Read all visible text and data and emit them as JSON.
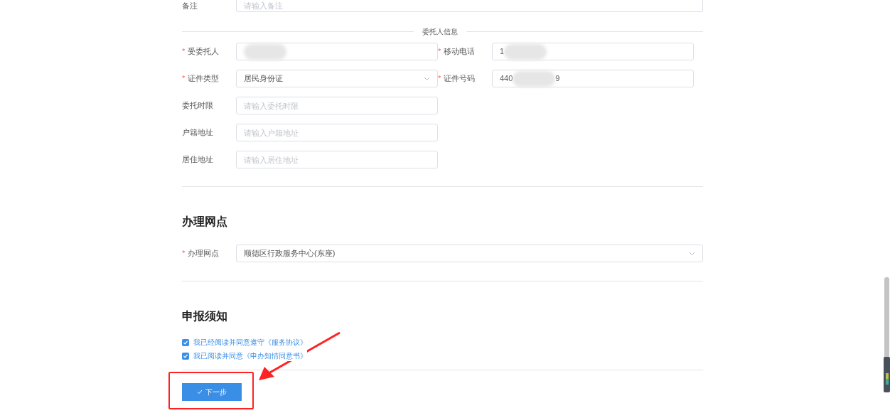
{
  "remark": {
    "label": "备注",
    "placeholder": "请输入备注"
  },
  "principal_section": {
    "title": "委托人信息",
    "fields": [
      {
        "label": "受委托人",
        "required_mark": "*",
        "kind": "blurred"
      },
      {
        "label": "移动电话",
        "required_mark": "*",
        "kind": "blurred",
        "value_start": "1"
      },
      {
        "label": "证件类型",
        "required_mark": "*",
        "kind": "select",
        "value": "居民身份证"
      },
      {
        "label": "证件号码",
        "required_mark": "*",
        "kind": "blurred",
        "value_start": "440",
        "value_end": "9"
      },
      {
        "label": "委托时限",
        "kind": "text",
        "placeholder": "请输入委托时限"
      },
      {
        "label": "户籍地址",
        "kind": "text",
        "placeholder": "请输入户籍地址"
      },
      {
        "label": "居住地址",
        "kind": "text",
        "placeholder": "请输入居住地址"
      }
    ]
  },
  "office_section": {
    "title": "办理网点",
    "field": {
      "label": "办理网点",
      "required_mark": "*",
      "value": "顺德区行政服务中心(东座)"
    }
  },
  "notice_section": {
    "title": "申报须知",
    "agreements": [
      {
        "label": "我已经阅读并同意遵守《服务协议》",
        "checked": true
      },
      {
        "label": "我已阅读并同意《申办知情同意书》",
        "checked": true
      }
    ]
  },
  "next_button": {
    "label": "下一步"
  }
}
